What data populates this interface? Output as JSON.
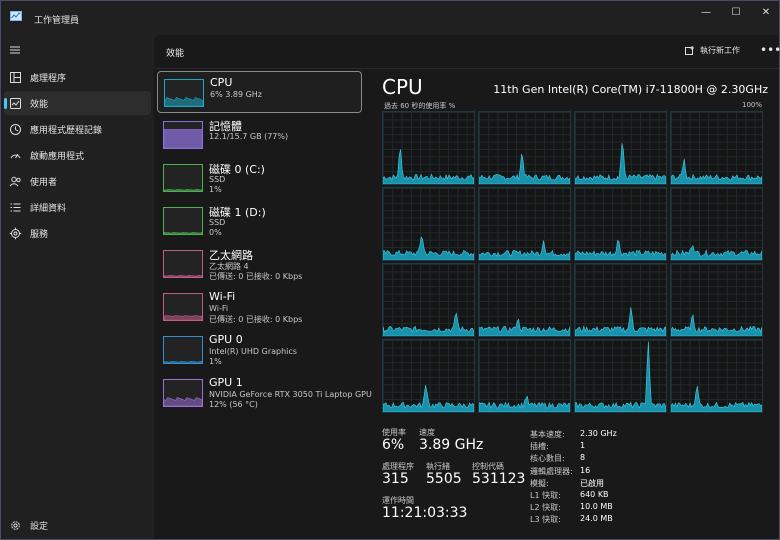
{
  "window": {
    "title": "工作管理員",
    "minimize": "—",
    "maximize": "☐",
    "close": "✕"
  },
  "sidebar": {
    "items": [
      {
        "label": "處理程序",
        "icon": "processes-icon"
      },
      {
        "label": "效能",
        "icon": "performance-icon"
      },
      {
        "label": "應用程式歷程記錄",
        "icon": "app-history-icon"
      },
      {
        "label": "啟動應用程式",
        "icon": "startup-apps-icon"
      },
      {
        "label": "使用者",
        "icon": "users-icon"
      },
      {
        "label": "詳細資料",
        "icon": "details-icon"
      },
      {
        "label": "服務",
        "icon": "services-icon"
      }
    ],
    "settings": {
      "label": "設定",
      "icon": "gear-icon"
    }
  },
  "header": {
    "title": "效能",
    "run_task": "執行新工作",
    "more": "•••"
  },
  "devices": [
    {
      "name": "CPU",
      "line1": "6%  3.89 GHz",
      "line2": "",
      "color": "#1aa7c4"
    },
    {
      "name": "記憶體",
      "line1": "12.1/15.7 GB (77%)",
      "line2": "",
      "color": "#8b6fd6"
    },
    {
      "name": "磁碟 0 (C:)",
      "line1": "SSD",
      "line2": "1%",
      "color": "#4fae4f"
    },
    {
      "name": "磁碟 1 (D:)",
      "line1": "SSD",
      "line2": "0%",
      "color": "#4fae4f"
    },
    {
      "name": "乙太網路",
      "line1": "乙太網路 4",
      "line2": "已傳送: 0  已接收: 0 Kbps",
      "color": "#c25d8a"
    },
    {
      "name": "Wi-Fi",
      "line1": "Wi-Fi",
      "line2": "已傳送: 0  已接收: 0 Kbps",
      "color": "#c25d8a"
    },
    {
      "name": "GPU 0",
      "line1": "Intel(R) UHD Graphics",
      "line2": "1%",
      "color": "#2f8fd4"
    },
    {
      "name": "GPU 1",
      "line1": "NVIDIA GeForce RTX 3050 Ti Laptop GPU",
      "line2": "12% (56 °C)",
      "color": "#9a6fd4"
    }
  ],
  "detail": {
    "title": "CPU",
    "model": "11th Gen Intel(R) Core(TM) i7-11800H @ 2.30GHz",
    "graph_label": "過去 60 秒的使用率 %",
    "graph_max": "100%",
    "stats": {
      "util_label": "使用率",
      "util_value": "6%",
      "speed_label": "速度",
      "speed_value": "3.89 GHz",
      "proc_label": "處理程序",
      "proc_value": "315",
      "thread_label": "執行緒",
      "thread_value": "5505",
      "handle_label": "控制代碼",
      "handle_value": "531123",
      "uptime_label": "運作時間",
      "uptime_value": "11:21:03:33"
    },
    "specs": [
      {
        "k": "基本速度:",
        "v": "2.30 GHz"
      },
      {
        "k": "插槽:",
        "v": "1"
      },
      {
        "k": "核心數目:",
        "v": "8"
      },
      {
        "k": "邏輯處理器:",
        "v": "16"
      },
      {
        "k": "模擬:",
        "v": "已啟用"
      },
      {
        "k": "L1 快取:",
        "v": "640 KB"
      },
      {
        "k": "L2 快取:",
        "v": "10.0 MB"
      },
      {
        "k": "L3 快取:",
        "v": "24.0 MB"
      }
    ]
  },
  "colors": {
    "accent": "#4cc2ff",
    "cpu_line": "#1aa7c4",
    "cpu_fill": "#0f5f70"
  }
}
